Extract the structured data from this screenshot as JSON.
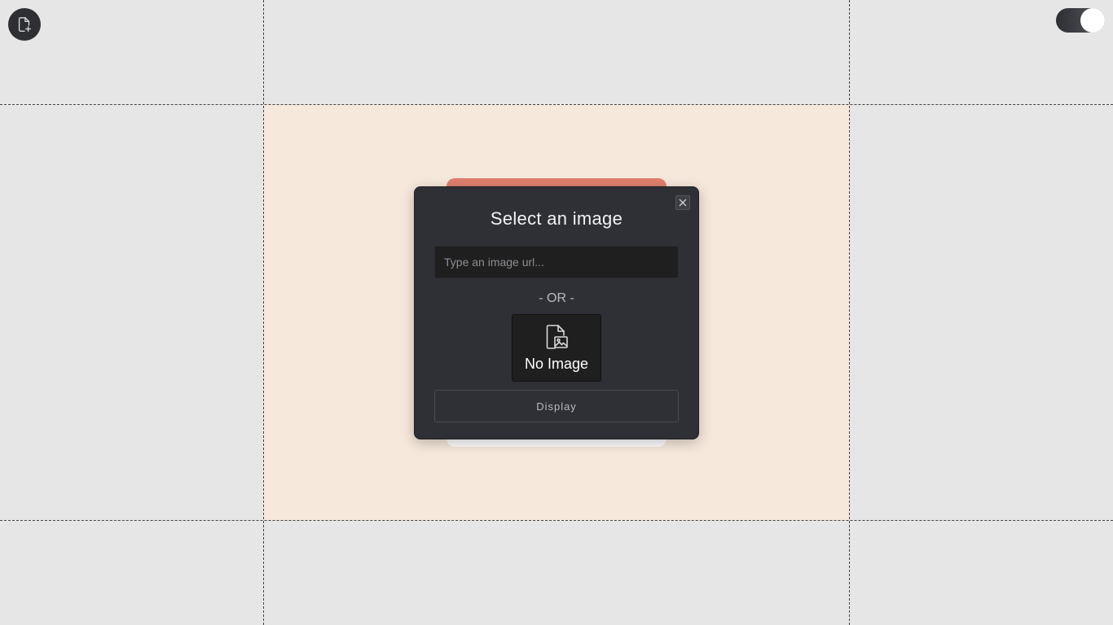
{
  "toolbar": {
    "new_file_icon": "file-plus-icon",
    "theme_toggle_state": "on"
  },
  "modal": {
    "title": "Select an image",
    "close_icon": "close-icon",
    "url_placeholder": "Type an image url...",
    "url_value": "",
    "separator": "- OR -",
    "picker_icon": "file-image-icon",
    "picker_label": "No Image",
    "display_label": "Display"
  },
  "colors": {
    "background": "#e6e6e6",
    "canvas": "#f6e8db",
    "modal": "#2f3035",
    "card_accent": "#e0806f"
  }
}
